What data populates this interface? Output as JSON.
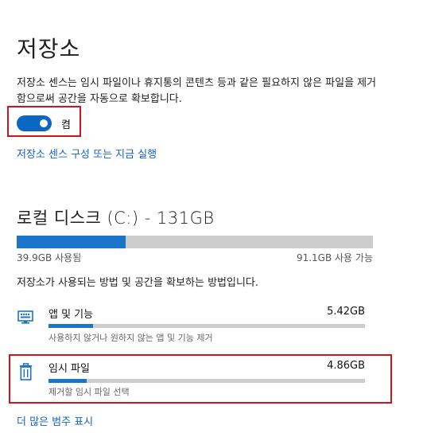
{
  "page": {
    "title": "저장소",
    "description": "저장소 센스는 임시 파일이나 휴지통의 콘텐츠 등과 같은 필요하지 않은 파일을 제거함으로써 공간을 자동으로 확보합니다.",
    "toggle": {
      "state": "on",
      "label": "켬"
    },
    "configure_link": "저장소 센스 구성 또는 지금 실행"
  },
  "disk": {
    "title": "로컬 디스크 (C:) - 131GB",
    "used_label": "39.9GB 사용됨",
    "free_label": "91.1GB 사용 가능",
    "used_fraction": 0.305,
    "info": "저장소가 사용되는 방법 및 공간을 확보하는 방법입니다.",
    "accent_color": "#1a74c8"
  },
  "categories": [
    {
      "icon": "monitor-icon",
      "title": "앱 및 기능",
      "size": "5.42GB",
      "subtitle": "사용하지 않거나 원하지 않는 앱 및 기능 제거",
      "fraction": 0.14
    },
    {
      "icon": "trash-icon",
      "title": "임시 파일",
      "size": "4.86GB",
      "subtitle": "제거할 임시 파일 선택",
      "fraction": 0.12
    }
  ],
  "more_link": "더 많은 범주 표시",
  "highlight_color": "#d3121a"
}
